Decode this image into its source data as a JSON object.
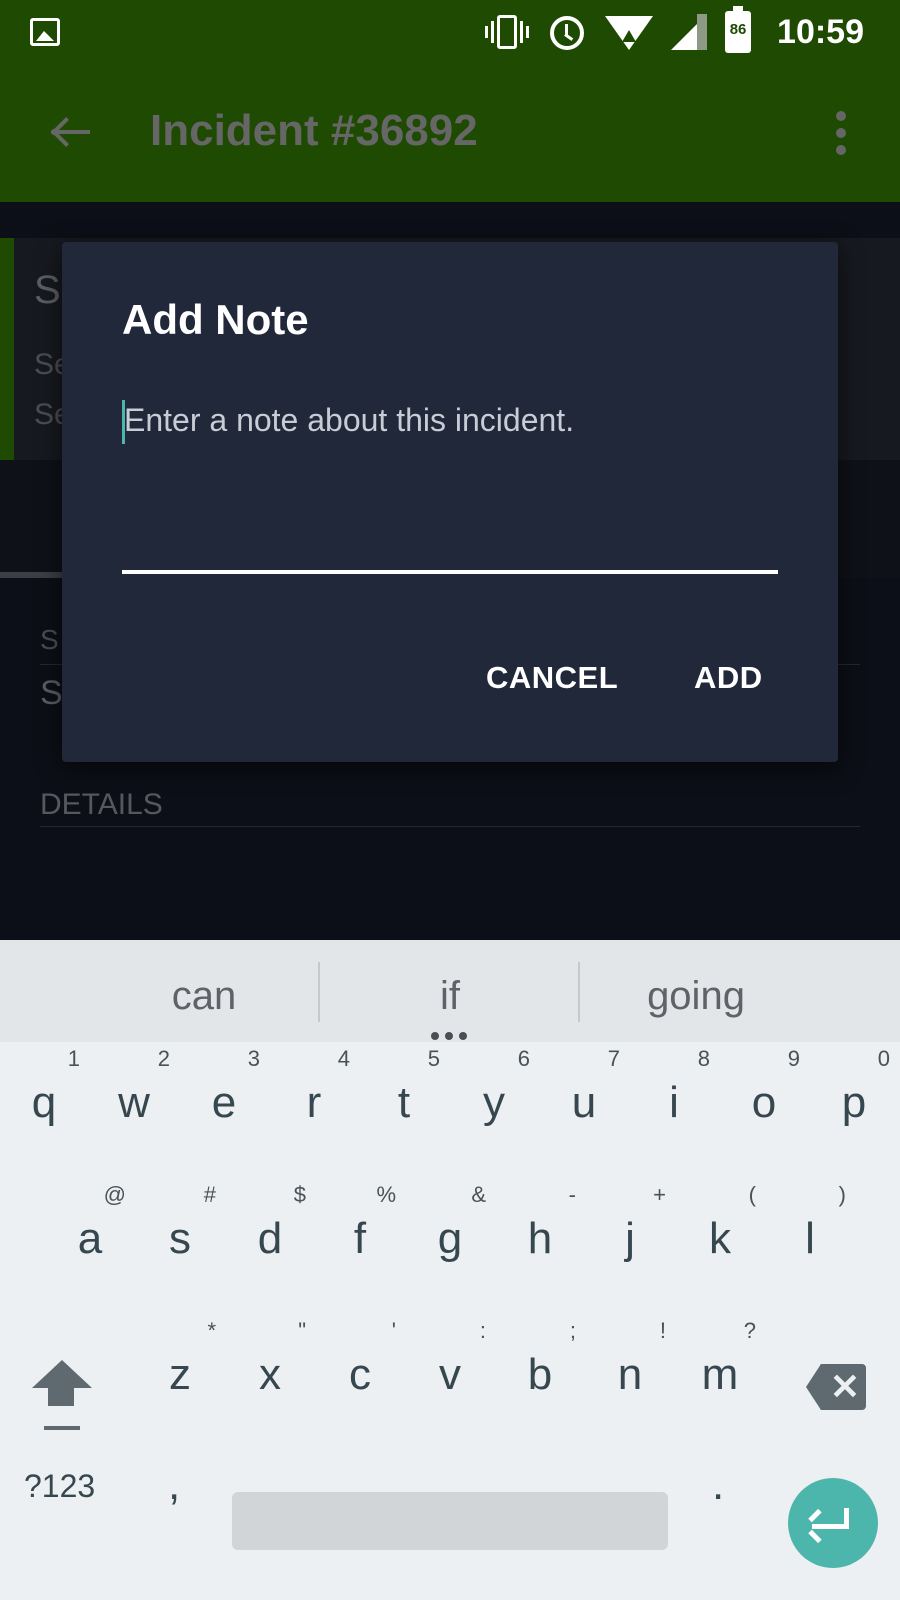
{
  "status_bar": {
    "time": "10:59",
    "battery": "86"
  },
  "toolbar": {
    "title": "Incident #36892"
  },
  "background": {
    "summary_title": "S",
    "summary_line1": "Se",
    "summary_line2": "Se",
    "section_label": "S",
    "section_value": "S",
    "details_label": "DETAILS"
  },
  "dialog": {
    "title": "Add Note",
    "placeholder": "Enter a note about this incident.",
    "cancel_label": "CANCEL",
    "add_label": "ADD"
  },
  "keyboard": {
    "suggestions": [
      "can",
      "if",
      "going"
    ],
    "row1": [
      {
        "ch": "q",
        "hint": "1"
      },
      {
        "ch": "w",
        "hint": "2"
      },
      {
        "ch": "e",
        "hint": "3"
      },
      {
        "ch": "r",
        "hint": "4"
      },
      {
        "ch": "t",
        "hint": "5"
      },
      {
        "ch": "y",
        "hint": "6"
      },
      {
        "ch": "u",
        "hint": "7"
      },
      {
        "ch": "i",
        "hint": "8"
      },
      {
        "ch": "o",
        "hint": "9"
      },
      {
        "ch": "p",
        "hint": "0"
      }
    ],
    "row2": [
      {
        "ch": "a",
        "hint": "@"
      },
      {
        "ch": "s",
        "hint": "#"
      },
      {
        "ch": "d",
        "hint": "$"
      },
      {
        "ch": "f",
        "hint": "%"
      },
      {
        "ch": "g",
        "hint": "&"
      },
      {
        "ch": "h",
        "hint": "-"
      },
      {
        "ch": "j",
        "hint": "+"
      },
      {
        "ch": "k",
        "hint": "("
      },
      {
        "ch": "l",
        "hint": ")"
      }
    ],
    "row3": [
      {
        "ch": "z",
        "hint": "*"
      },
      {
        "ch": "x",
        "hint": "\""
      },
      {
        "ch": "c",
        "hint": "'"
      },
      {
        "ch": "v",
        "hint": ":"
      },
      {
        "ch": "b",
        "hint": ";"
      },
      {
        "ch": "n",
        "hint": "!"
      },
      {
        "ch": "m",
        "hint": "?"
      }
    ],
    "symbols_label": "?123",
    "comma": ",",
    "period": "."
  },
  "colors": {
    "app_bar": "#1e4a02",
    "dialog_bg": "#20283a",
    "accent": "#4db6ac",
    "keyboard_bg": "#edf0f2"
  }
}
